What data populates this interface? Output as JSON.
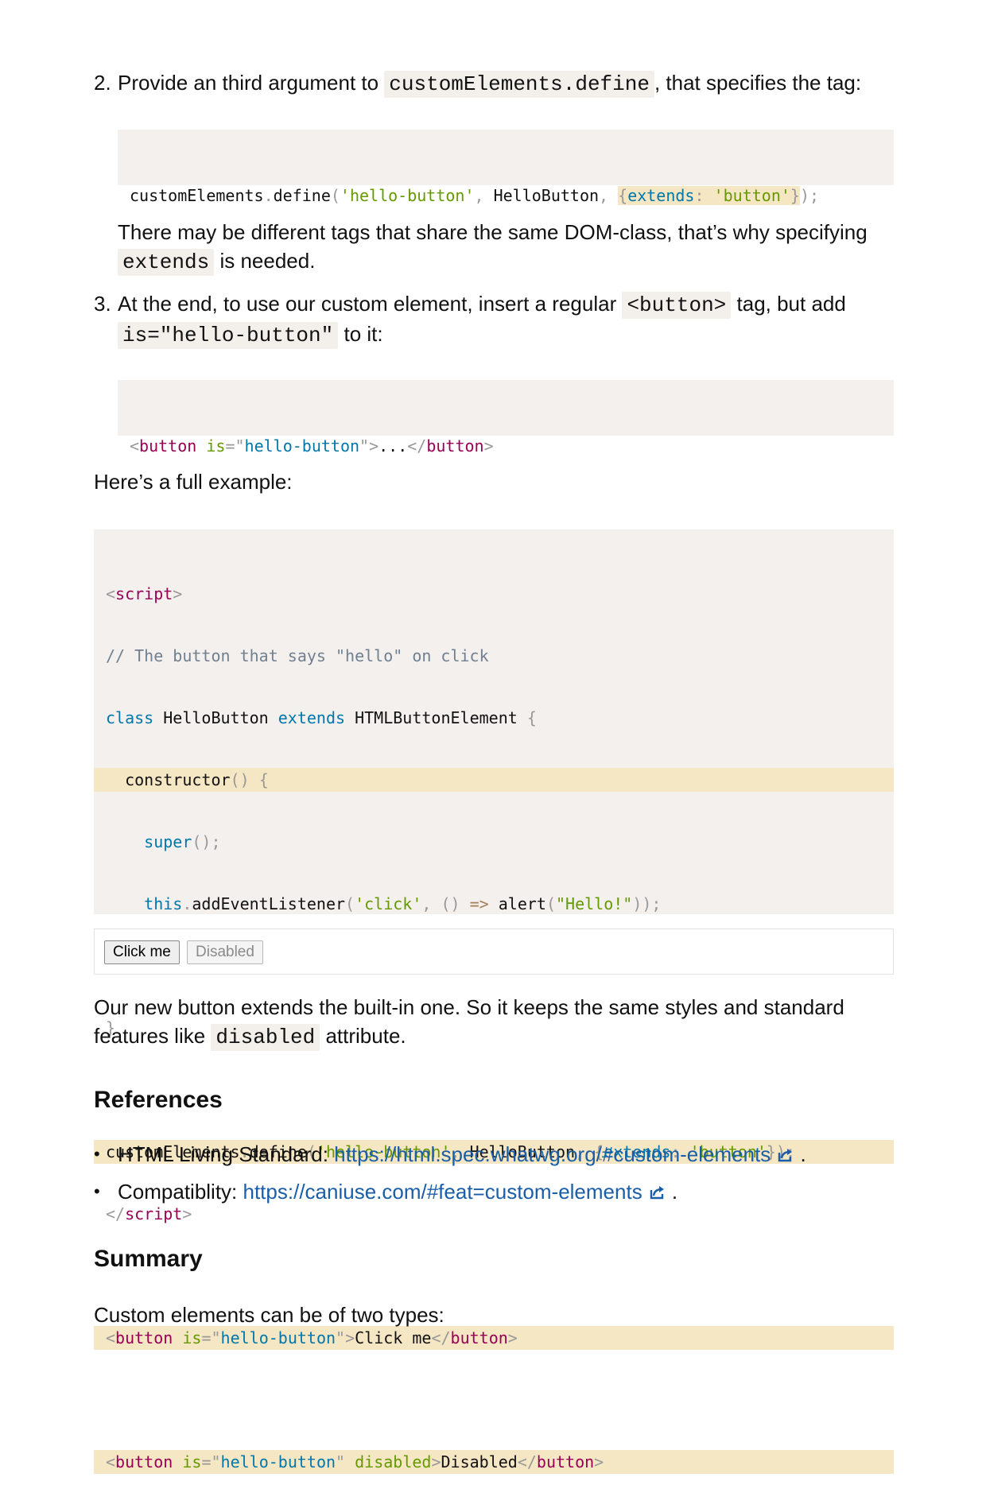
{
  "steps": [
    {
      "number": "2.",
      "text_before": "Provide an third argument to ",
      "code": "customElements.define",
      "text_after": ", that specifies the tag:",
      "note_before": "There may be different tags that share the same DOM-class, that’s why specifying ",
      "note_code": "extends",
      "note_after": " is needed."
    },
    {
      "number": "3.",
      "text_before": "At the end, to use our custom element, insert a regular ",
      "code": "<button>",
      "text_mid": " tag, but add ",
      "code2": "is=\"hello-button\"",
      "text_after": " to it:"
    }
  ],
  "code_define": {
    "obj": "customElements",
    "dot": ".",
    "fn": "define",
    "p1": "(",
    "s1": "'hello-button'",
    "comma1": ", ",
    "cls": "HelloButton",
    "comma2": ", ",
    "brace_open": "{",
    "key": "extends",
    "colon": ": ",
    "s2": "'button'",
    "brace_close": "}",
    "end": ");"
  },
  "code_button": {
    "lt": "<",
    "tag": "button",
    "attr": "is",
    "eq": "=\"",
    "val": "hello-button",
    "q": "\"",
    "gt": ">",
    "content": "...",
    "close_lt": "</",
    "close_tag": "button",
    "close_gt": ">"
  },
  "full_example_label": "Here’s a full example:",
  "full_example": {
    "l1": {
      "lt": "<",
      "tag": "script",
      "gt": ">"
    },
    "l2": "// The button that says \"hello\" on click",
    "l3": {
      "kw1": "class",
      "name": " HelloButton ",
      "kw2": "extends",
      "base": " HTMLButtonElement ",
      "brace": "{"
    },
    "l4": {
      "fn": "constructor",
      "paren": "()",
      "brace": "{"
    },
    "l5": {
      "kw": "super",
      "end": "();"
    },
    "l6": {
      "kw": "this",
      "dot": ".",
      "fn": "addEventListener",
      "p1": "(",
      "s1": "'click'",
      "comma": ", ",
      "args": "() ",
      "arrow": "=>",
      "call": " alert",
      "p2": "(",
      "s2": "\"Hello!\"",
      "end": "));"
    },
    "l7": "}",
    "l8": "}",
    "l10": {
      "obj": "customElements",
      "dot": ".",
      "fn": "define",
      "p1": "(",
      "s1": "'hello-button'",
      "c1": ", ",
      "cls": "HelloButton",
      "c2": ", ",
      "b1": "{",
      "key": "extends",
      "colon": ": ",
      "s2": "'button'",
      "b2": "}",
      "end": ");"
    },
    "l11": {
      "lt": "</",
      "tag": "script",
      "gt": ">"
    },
    "l13": {
      "lt": "<",
      "tag": "button",
      "sp": " ",
      "attr": "is",
      "eq": "=\"",
      "val": "hello-button",
      "q": "\"",
      "gt": ">",
      "content": "Click me",
      "clt": "</",
      "ctag": "button",
      "cgt": ">"
    },
    "l15": {
      "lt": "<",
      "tag": "button",
      "sp": " ",
      "attr": "is",
      "eq": "=\"",
      "val": "hello-button",
      "q": "\" ",
      "attr2": "disabled",
      "gt": ">",
      "content": "Disabled",
      "clt": "</",
      "ctag": "button",
      "cgt": ">"
    }
  },
  "demo": {
    "btn1": "Click me",
    "btn2": "Disabled"
  },
  "explanation": {
    "line1": "Our new button extends the built-in one. So it keeps the same styles and standard",
    "line2_before": "features like ",
    "line2_code": "disabled",
    "line2_after": " attribute."
  },
  "references": {
    "heading": "References",
    "items": [
      {
        "label": "HTML Living Standard: ",
        "link": "https://html.spec.whatwg.org/#custom-elements",
        "after": " ."
      },
      {
        "label": "Compatiblity: ",
        "link": "https://caniuse.com/#feat=custom-elements",
        "after": " ."
      }
    ]
  },
  "summary": {
    "heading": "Summary",
    "text": "Custom elements can be of two types:"
  },
  "colors": {
    "link": "#1a5ea8",
    "code_bg": "#f3f0ee",
    "highlight": "#f5e6c4",
    "keyword": "#0077aa",
    "string": "#669900",
    "tag": "#990055"
  },
  "icons": [
    "external-link-icon"
  ]
}
